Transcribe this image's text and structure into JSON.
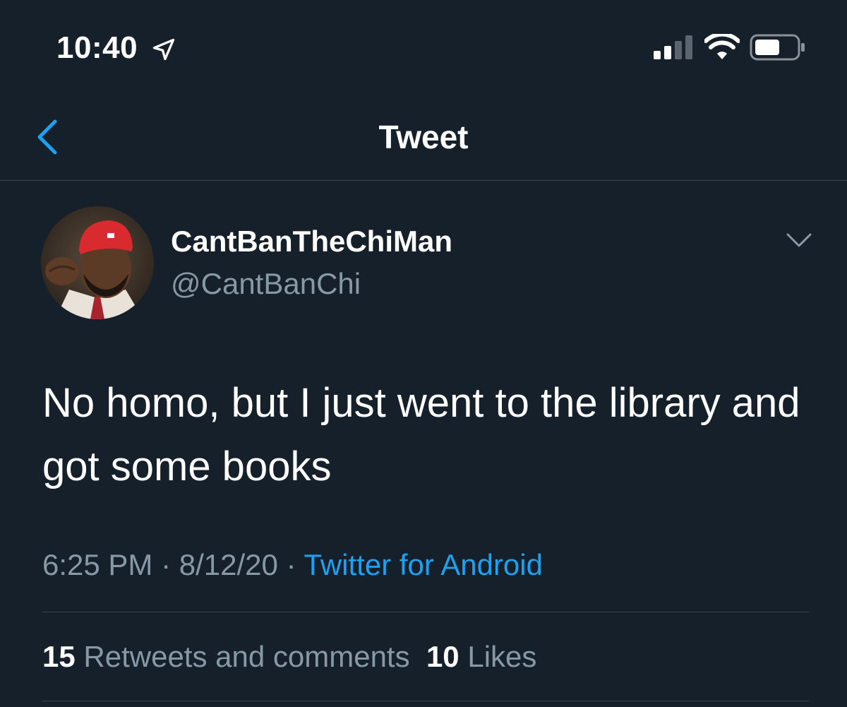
{
  "status_bar": {
    "time": "10:40",
    "location_icon": "location-arrow-icon",
    "signal_icon": "cellular-signal-icon",
    "wifi_icon": "wifi-icon",
    "battery_icon": "battery-icon"
  },
  "header": {
    "back_icon": "chevron-left-icon",
    "title": "Tweet"
  },
  "tweet": {
    "author": {
      "display_name": "CantBanTheChiMan",
      "handle": "@CantBanChi",
      "avatar_icon": "profile-photo"
    },
    "text": "No homo, but I just went to the library and got some books",
    "time": "6:25 PM",
    "separator": "·",
    "date": "8/12/20",
    "source": "Twitter for Android",
    "stats": {
      "retweets_count": "15",
      "retweets_label": "Retweets and comments",
      "likes_count": "10",
      "likes_label": "Likes"
    }
  },
  "colors": {
    "background": "#15202b",
    "text_primary": "#ffffff",
    "text_secondary": "#8899a6",
    "accent": "#1da1f2",
    "divider": "#38444d"
  }
}
